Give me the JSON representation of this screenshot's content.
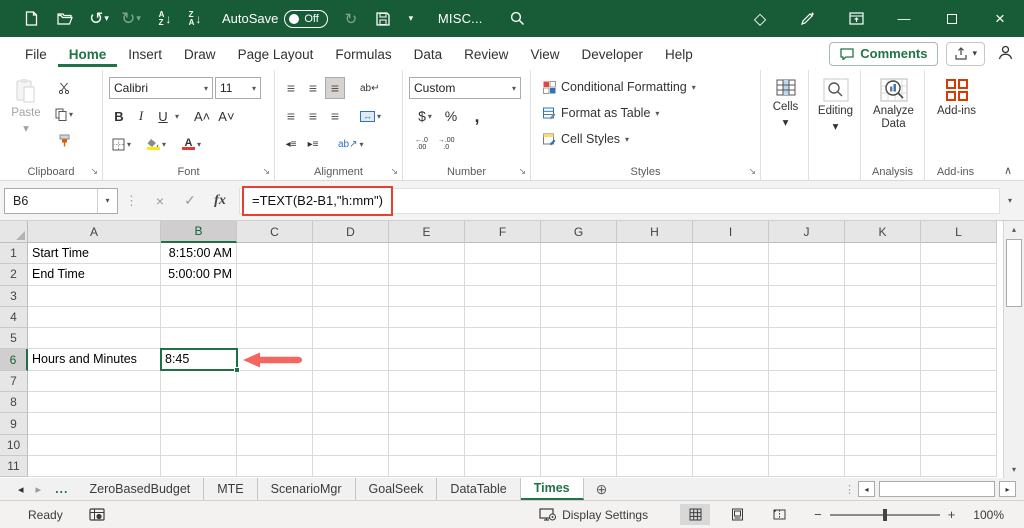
{
  "window": {
    "filename": "MISC...",
    "autosave_label": "AutoSave",
    "autosave_state": "Off"
  },
  "ribbon_tabs": {
    "items": [
      "File",
      "Home",
      "Insert",
      "Draw",
      "Page Layout",
      "Formulas",
      "Data",
      "Review",
      "View",
      "Developer",
      "Help"
    ],
    "active": "Home"
  },
  "top_right": {
    "comments_label": "Comments"
  },
  "ribbon": {
    "clipboard": {
      "paste_label": "Paste",
      "group_label": "Clipboard"
    },
    "font": {
      "family": "Calibri",
      "size": "11",
      "bold": "B",
      "italic": "I",
      "underline": "U",
      "group_label": "Font"
    },
    "alignment": {
      "wrap_text": "ab↵",
      "orientation": "ab↗",
      "group_label": "Alignment"
    },
    "number": {
      "format": "Custom",
      "currency": "$",
      "percent": "%",
      "comma": ",",
      "inc_dec_top": "←.0",
      "inc_dec_bot": ".00",
      "dec_dec_top": "→.00",
      "dec_dec_bot": ".0",
      "group_label": "Number"
    },
    "styles": {
      "conditional_formatting": "Conditional Formatting",
      "format_as_table": "Format as Table",
      "cell_styles": "Cell Styles",
      "group_label": "Styles"
    },
    "cells": {
      "button_label": "Cells"
    },
    "editing": {
      "button_label": "Editing"
    },
    "analysis": {
      "button_label": "Analyze Data",
      "group_label": "Analysis"
    },
    "addins": {
      "button_label": "Add-ins",
      "group_label": "Add-ins"
    }
  },
  "formula_bar": {
    "name_box": "B6",
    "formula": "=TEXT(B2-B1,\"h:mm\")"
  },
  "grid": {
    "columns": [
      "A",
      "B",
      "C",
      "D",
      "E",
      "F",
      "G",
      "H",
      "I",
      "J",
      "K",
      "L"
    ],
    "rows": [
      "1",
      "2",
      "3",
      "4",
      "5",
      "6",
      "7",
      "8",
      "9",
      "10",
      "11"
    ],
    "cells": [
      {
        "ref": "A1",
        "text": "Start Time",
        "align": "left"
      },
      {
        "ref": "B1",
        "text": "8:15:00 AM",
        "align": "right"
      },
      {
        "ref": "A2",
        "text": "End Time",
        "align": "left"
      },
      {
        "ref": "B2",
        "text": "5:00:00 PM",
        "align": "right"
      },
      {
        "ref": "A6",
        "text": "Hours and Minutes",
        "align": "left"
      },
      {
        "ref": "B6",
        "text": "8:45",
        "align": "left"
      }
    ],
    "selected_cell": "B6",
    "selected_column": "B",
    "selected_row": "6"
  },
  "sheet_bar": {
    "overflow": "...",
    "tabs": [
      "ZeroBasedBudget",
      "MTE",
      "ScenarioMgr",
      "GoalSeek",
      "DataTable",
      "Times"
    ],
    "active_tab": "Times"
  },
  "status_bar": {
    "mode": "Ready",
    "display_settings": "Display Settings",
    "zoom_level": "100%"
  },
  "icons": {
    "chevron_down": "▾",
    "chevron_up": "∧",
    "undo": "↺",
    "redo": "↻",
    "sync": "↻",
    "cancel": "×",
    "confirm": "✓",
    "fx": "fx",
    "dots": "⋮",
    "hdots": "⋮",
    "add_sheet": "⊕",
    "nav_left": "◂",
    "nav_right": "▸",
    "scroll_up": "▴",
    "scroll_down": "▾",
    "scroll_left": "◂",
    "scroll_right": "▸",
    "minus": "−",
    "plus": "+",
    "launcher": "↘",
    "sort_a": "A",
    "sort_z": "Z",
    "sort_arrow": "↓",
    "align_lines": "≡",
    "indent_left": "◂≡",
    "indent_right": "▸≡",
    "merge_arrows": "↔",
    "gem": "◇",
    "minimize": "—",
    "close": "×",
    "font_bigger": "A˄",
    "font_smaller": "A˅"
  },
  "colors": {
    "titlebar_green": "#185C37",
    "accent_green": "#217346",
    "selection_green": "#1E7145",
    "formula_highlight_red": "#E8402D",
    "arrow_red": "#F4665F",
    "addins_orange": "#D83B01",
    "fill_yellow": "#FFE812",
    "font_color_red": "#E03A3A"
  }
}
